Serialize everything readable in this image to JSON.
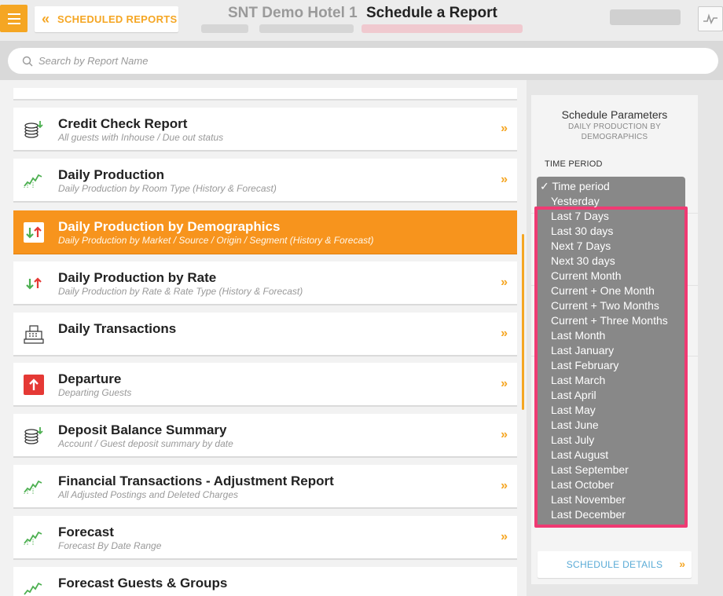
{
  "header": {
    "back_label": "SCHEDULED REPORTS",
    "hotel_name": "SNT Demo Hotel 1",
    "page_title": "Schedule a Report"
  },
  "search": {
    "placeholder": "Search by Report Name"
  },
  "reports": [
    {
      "title": "Credit Check Report",
      "subtitle": "All guests with Inhouse / Due out status",
      "icon": "coins-icon"
    },
    {
      "title": "Daily Production",
      "subtitle": "Daily Production by Room Type (History & Forecast)",
      "icon": "trend-chart-icon"
    },
    {
      "title": "Daily Production by Demographics",
      "subtitle": "Daily Production by Market / Source / Origin / Segment (History & Forecast)",
      "icon": "up-down-arrows-icon",
      "active": true
    },
    {
      "title": "Daily Production by Rate",
      "subtitle": "Daily Production by Rate & Rate Type (History & Forecast)",
      "icon": "up-down-arrows-icon"
    },
    {
      "title": "Daily Transactions",
      "subtitle": "",
      "icon": "cash-register-icon"
    },
    {
      "title": "Departure",
      "subtitle": "Departing Guests",
      "icon": "departure-arrow-icon"
    },
    {
      "title": "Deposit Balance Summary",
      "subtitle": "Account / Guest deposit summary by date",
      "icon": "coins-icon"
    },
    {
      "title": "Financial Transactions - Adjustment Report",
      "subtitle": "All Adjusted Postings and Deleted Charges",
      "icon": "trend-chart-icon"
    },
    {
      "title": "Forecast",
      "subtitle": "Forecast By Date Range",
      "icon": "trend-chart-icon"
    },
    {
      "title": "Forecast Guests & Groups",
      "subtitle": "",
      "icon": "trend-chart-icon"
    }
  ],
  "panel": {
    "title": "Schedule Parameters",
    "subtitle": "DAILY PRODUCTION BY DEMOGRAPHICS",
    "time_period_label": "TIME PERIOD",
    "schedule_details_label": "SCHEDULE DETAILS"
  },
  "time_period_dropdown": {
    "selected": "Time period",
    "options": [
      "Time period",
      "Yesterday",
      "Last 7 Days",
      "Last 30 days",
      "Next 7 Days",
      "Next 30 days",
      "Current Month",
      "Current + One Month",
      "Current + Two Months",
      "Current + Three Months",
      "Last Month",
      "Last January",
      "Last February",
      "Last March",
      "Last April",
      "Last May",
      "Last June",
      "Last July",
      "Last August",
      "Last September",
      "Last October",
      "Last November",
      "Last December"
    ]
  },
  "colors": {
    "accent": "#f5a623",
    "active_row": "#f7941d",
    "link": "#5aabd6",
    "highlight": "#ef3a73",
    "dropdown_bg": "#888888"
  }
}
